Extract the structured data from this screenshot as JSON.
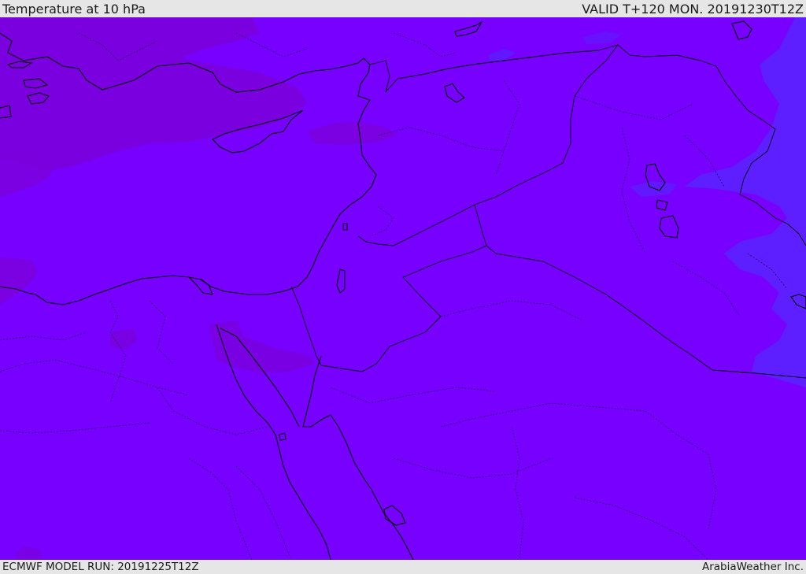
{
  "header": {
    "title": "Temperature at 10 hPa",
    "valid_time": "VALID T+120 MON. 20191230T12Z"
  },
  "footer": {
    "model_run": "ECMWF MODEL RUN: 20191225T12Z",
    "provider": "ArabiaWeather Inc."
  },
  "map": {
    "field_color": "#7700ff",
    "cold_region_color": "#7b00dd",
    "warm_region_color": "#5a22ff",
    "coastline_color": "#000000",
    "border_color": "#1a0040"
  }
}
